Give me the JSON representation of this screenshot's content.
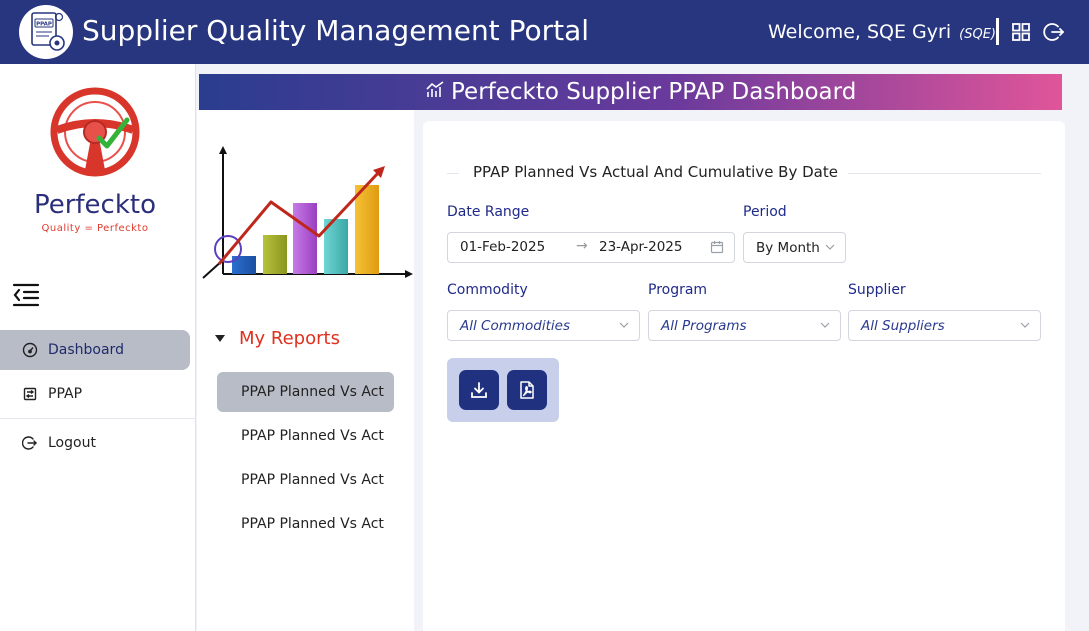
{
  "header": {
    "title": "Supplier Quality Management Portal",
    "logo_badge": "PPAP",
    "welcome_text": "Welcome, SQE Gyri",
    "role": "(SQE)",
    "icons": [
      "apps-grid-icon",
      "logout-icon"
    ]
  },
  "sidebar": {
    "brand_name": "Perfeckto",
    "brand_tagline": "Quality = Perfeckto",
    "items": [
      {
        "label": "Dashboard",
        "icon": "dashboard-gauge-icon",
        "active": true
      },
      {
        "label": "PPAP",
        "icon": "ppap-document-icon",
        "active": false
      },
      {
        "label": "Logout",
        "icon": "logout-icon",
        "active": false
      }
    ]
  },
  "banner": {
    "title": "Perfeckto Supplier PPAP Dashboard",
    "icon": "analytics-chart-icon"
  },
  "reports": {
    "title": "My Reports",
    "items": [
      {
        "label": "PPAP Planned Vs Act",
        "active": true
      },
      {
        "label": "PPAP Planned Vs Act",
        "active": false
      },
      {
        "label": "PPAP Planned Vs Act",
        "active": false
      },
      {
        "label": "PPAP Planned Vs Act",
        "active": false
      }
    ]
  },
  "filters": {
    "section_title": "PPAP Planned Vs Actual And Cumulative By Date",
    "date_range_label": "Date Range",
    "date_start": "01-Feb-2025",
    "date_end": "23-Apr-2025",
    "period_label": "Period",
    "period_value": "By Month",
    "commodity_label": "Commodity",
    "commodity_value": "All Commodities",
    "program_label": "Program",
    "program_value": "All Programs",
    "supplier_label": "Supplier",
    "supplier_value": "All Suppliers"
  },
  "actions": {
    "download_icon": "download-icon",
    "pdf_icon": "pdf-file-icon"
  },
  "colors": {
    "header_bg": "#27367f",
    "accent_red": "#e0301e",
    "label_blue": "#1f2a8a",
    "button_bg": "#203180"
  }
}
